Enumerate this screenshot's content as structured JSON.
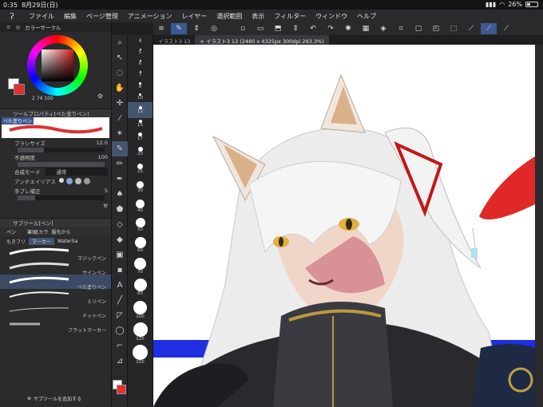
{
  "status": {
    "time": "0:35",
    "date": "8月29日(日)",
    "battery": "26%"
  },
  "menu": [
    "ファイル",
    "編集",
    "ページ管理",
    "アニメーション",
    "レイヤー",
    "選択範囲",
    "表示",
    "フィルター",
    "ウィンドウ",
    "ヘルプ"
  ],
  "colorCircle": {
    "title": "カラーサークル",
    "values": "2   74   100"
  },
  "toolProperty": {
    "title": "ツールプロパティ[べた塗りペン]",
    "brushName": "べた塗りペン",
    "brushSizeLabel": "ブラシサイズ",
    "brushSize": "12.0",
    "opacityLabel": "不透明度",
    "opacity": "100",
    "blendLabel": "合成モード",
    "blendValue": "通常",
    "aaLabel": "アンチエイリアス",
    "stabLabel": "手ブレ補正",
    "stabValue": "5"
  },
  "subTool": {
    "title": "サブツール[ペン]",
    "groups": [
      "ペン",
      "筆頭[カラ",
      "服先から"
    ],
    "tabs": [
      "もきフリ",
      "マーカー",
      "WaterSa"
    ],
    "brushes": [
      "マジックペン",
      "サインペン",
      "べた塗りペン",
      "ミリペン",
      "ドットペン",
      "フラットマーカー"
    ],
    "addLabel": "サブツールを追加する"
  },
  "sizes": [
    "4",
    "5",
    "6",
    "7",
    "8",
    "10",
    "12",
    "15",
    "17",
    "20",
    "25",
    "30",
    "40",
    "50",
    "60",
    "70",
    "80",
    "100",
    "120",
    "150"
  ],
  "docTabs": [
    "イラスト3 13",
    "× イラスト3 12 (2480 x 4325px 300dpi 283.3%)"
  ],
  "colors": {
    "accent": "#46556e",
    "mainColor": "#ffffff",
    "subColor": "#e03030"
  }
}
